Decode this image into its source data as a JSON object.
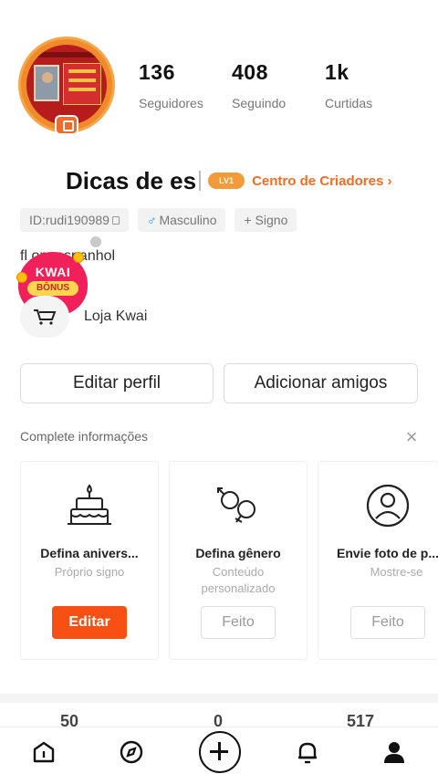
{
  "profile": {
    "stats": [
      {
        "value": "136",
        "label": "Seguidores"
      },
      {
        "value": "408",
        "label": "Seguindo"
      },
      {
        "value": "1k",
        "label": "Curtidas"
      }
    ],
    "name": "Dicas de es",
    "level_badge": "LV1",
    "creator_center": "Centro de Criadores",
    "tags": {
      "id": "ID:rudi190989",
      "gender": "Masculino",
      "sign": "+ Signo"
    },
    "bio": "fl         om espanhol",
    "shop_label": "Loja Kwai"
  },
  "kwai_bonus": {
    "line1": "KWAI",
    "line2": "BÔNUS"
  },
  "buttons": {
    "edit_profile": "Editar perfil",
    "add_friends": "Adicionar amigos"
  },
  "complete": {
    "title": "Complete informações",
    "cards": [
      {
        "icon": "cake-icon",
        "title": "Defina anivers...",
        "sub": "Próprio signo",
        "action": "Editar"
      },
      {
        "icon": "gender-icon",
        "title": "Defina gênero",
        "sub": "Conteúdo personalizado",
        "action": "Feito"
      },
      {
        "icon": "user-circle-icon",
        "title": "Envie foto de p...",
        "sub": "Mostre-se",
        "action": "Feito"
      }
    ]
  },
  "bottom_stats": [
    "50",
    "0",
    "517"
  ],
  "nav": [
    "home-icon",
    "discover-icon",
    "create-icon",
    "notifications-icon",
    "profile-icon"
  ],
  "colors": {
    "accent": "#f65013",
    "creator": "#f26c22",
    "male": "#2196f3",
    "bonus": "#f0215a"
  }
}
